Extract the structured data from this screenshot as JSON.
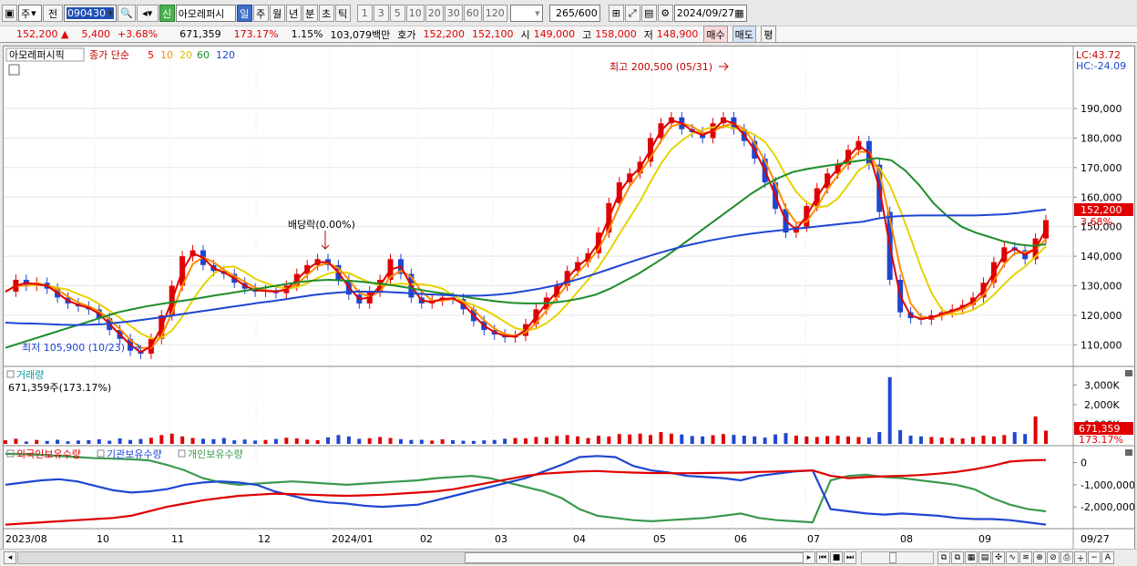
{
  "toolbar": {
    "mode": "주",
    "prev_label": "전",
    "code": "090430",
    "new_label": "신",
    "stock_name": "아모레퍼시",
    "periods": [
      "일",
      "주",
      "월",
      "년",
      "분",
      "초",
      "틱"
    ],
    "active_period": "일",
    "intervals": [
      "1",
      "3",
      "5",
      "10",
      "20",
      "30",
      "60",
      "120"
    ],
    "count_shown": "265",
    "count_total": "/600",
    "date": "2024/09/27"
  },
  "quote": {
    "price": "152,200",
    "change": "5,400",
    "change_pct": "+3.68%",
    "volume": "671,359",
    "volume_ratio": "173.17%",
    "turnover_pct": "1.15%",
    "amount": "103,079백만",
    "hoga_label": "호가",
    "ask": "152,200",
    "bid": "152,100",
    "open_label": "시",
    "open": "149,000",
    "high_label": "고",
    "high": "158,000",
    "low_label": "저",
    "low": "148,900",
    "buy_label": "매수",
    "sell_label": "매도",
    "eval_label": "평"
  },
  "legend": {
    "name": "아모레퍼시픽",
    "ma_label": "종가 단순",
    "mas": [
      "5",
      "10",
      "20",
      "60",
      "120"
    ],
    "ma_colors": [
      "#e00000",
      "#ff8c00",
      "#e6d200",
      "#1e8c2a",
      "#1e46d2"
    ]
  },
  "lc_label": "LC:43.72",
  "hc_label": "HC:-24.09",
  "chart_data": [
    {
      "type": "line",
      "title": "아모레퍼시픽",
      "y_ticks": [
        "190,000",
        "180,000",
        "170,000",
        "160,000",
        "150,000",
        "140,000",
        "130,000",
        "120,000",
        "110,000"
      ],
      "ylim": [
        103000,
        211000
      ],
      "last_price_label": "152,200",
      "last_pct_label": "3.68%",
      "annotations": {
        "high": "최고 200,500 (05/31)",
        "low": "최저 105,900 (10/23)",
        "dividend": "배당락(0.00%)"
      },
      "x_ticks": [
        "2023/08",
        "10",
        "11",
        "12",
        "2024/01",
        "02",
        "03",
        "04",
        "05",
        "06",
        "07",
        "08",
        "09",
        "09/27"
      ],
      "closes": [
        128000,
        132000,
        130000,
        131000,
        129000,
        126000,
        124000,
        123000,
        122000,
        119000,
        115000,
        112000,
        108000,
        107000,
        112000,
        120000,
        130000,
        140000,
        142000,
        137000,
        135000,
        134000,
        131000,
        129000,
        128000,
        128500,
        127500,
        130000,
        134000,
        137000,
        139000,
        137000,
        132000,
        127000,
        124000,
        128000,
        132000,
        139000,
        134000,
        126000,
        124000,
        125000,
        126000,
        125500,
        122000,
        118000,
        115000,
        113500,
        112500,
        113000,
        117000,
        122000,
        126000,
        130000,
        135000,
        138000,
        141000,
        148000,
        158000,
        165000,
        168000,
        172000,
        180000,
        185000,
        187000,
        183000,
        182000,
        180000,
        185000,
        187000,
        183000,
        179000,
        173000,
        165000,
        156000,
        148000,
        150000,
        157000,
        163000,
        168000,
        171000,
        176000,
        179000,
        171000,
        155000,
        132000,
        121000,
        119000,
        118500,
        120000,
        121000,
        122000,
        123500,
        126000,
        131000,
        138000,
        143000,
        142000,
        139000,
        146000,
        152200
      ],
      "ma60": [
        109000,
        110500,
        112000,
        113500,
        115000,
        116500,
        118000,
        119500,
        121000,
        122000,
        123000,
        123800,
        124500,
        125200,
        126000,
        126800,
        127500,
        128300,
        129000,
        129800,
        130600,
        131300,
        131800,
        132000,
        131800,
        131500,
        131000,
        130500,
        129800,
        129000,
        128200,
        127500,
        126800,
        126000,
        125300,
        124700,
        124200,
        124000,
        124000,
        124300,
        124900,
        125800,
        127000,
        129000,
        131500,
        134000,
        137000,
        140000,
        143500,
        147000,
        150500,
        154000,
        157500,
        161000,
        164000,
        166500,
        168500,
        169500,
        170300,
        171000,
        171800,
        172500,
        173200,
        172500,
        169000,
        164000,
        158000,
        153500,
        150000,
        148000,
        146500,
        145000,
        144000,
        143500,
        144000
      ],
      "ma120": [
        117500,
        117300,
        117200,
        117000,
        116800,
        116700,
        116800,
        117000,
        117500,
        118000,
        118600,
        119300,
        120000,
        120700,
        121400,
        122100,
        122800,
        123500,
        124200,
        124800,
        125500,
        126200,
        126900,
        127400,
        127800,
        128000,
        128000,
        127900,
        127700,
        127400,
        127100,
        126900,
        126700,
        126600,
        126700,
        127000,
        127500,
        128200,
        129000,
        130000,
        131200,
        132600,
        134100,
        135700,
        137300,
        138900,
        140400,
        141800,
        143100,
        144200,
        145200,
        146100,
        146900,
        147600,
        148200,
        148700,
        149200,
        149700,
        150200,
        150700,
        151200,
        151700,
        152700,
        153400,
        153700,
        153800,
        153800,
        153800,
        153800,
        153800,
        154000,
        154200,
        154600,
        155200,
        155800
      ]
    },
    {
      "type": "bar",
      "title": "거래량",
      "caption": "671,359주(173.17%)",
      "y_ticks": [
        "3,000K",
        "2,000K",
        "1,000K"
      ],
      "ylim": [
        0,
        3900
      ],
      "unit": "K",
      "last_label": "671,359",
      "last_pct_label": "173.17%",
      "values": [
        180,
        260,
        120,
        200,
        150,
        210,
        130,
        170,
        190,
        230,
        160,
        280,
        200,
        250,
        310,
        450,
        520,
        380,
        300,
        260,
        240,
        300,
        180,
        220,
        170,
        200,
        250,
        310,
        280,
        220,
        190,
        330,
        450,
        380,
        260,
        290,
        350,
        300,
        240,
        200,
        210,
        170,
        230,
        190,
        160,
        150,
        180,
        200,
        260,
        300,
        280,
        350,
        320,
        400,
        450,
        380,
        300,
        420,
        380,
        500,
        480,
        520,
        450,
        600,
        520,
        480,
        400,
        380,
        440,
        500,
        460,
        420,
        380,
        320,
        480,
        550,
        420,
        380,
        350,
        400,
        420,
        380,
        350,
        320,
        600,
        3400,
        700,
        420,
        380,
        350,
        320,
        300,
        280,
        350,
        420,
        380,
        450,
        600,
        500,
        1400,
        671
      ]
    },
    {
      "type": "line",
      "series_names": [
        "외국인보유수량",
        "기관보유수량",
        "개인보유수량"
      ],
      "series_colors": [
        "#e00000",
        "#1e46d2",
        "#3a9a4e"
      ],
      "y_ticks": [
        "0",
        "-1,000,000",
        "-2,000,000"
      ],
      "ylim": [
        -2900000,
        600000
      ],
      "foreign": [
        -2800000,
        -2750000,
        -2700000,
        -2650000,
        -2600000,
        -2550000,
        -2500000,
        -2400000,
        -2200000,
        -2000000,
        -1850000,
        -1700000,
        -1600000,
        -1500000,
        -1450000,
        -1400000,
        -1420000,
        -1450000,
        -1480000,
        -1500000,
        -1480000,
        -1450000,
        -1400000,
        -1350000,
        -1300000,
        -1200000,
        -1050000,
        -900000,
        -750000,
        -600000,
        -500000,
        -450000,
        -400000,
        -380000,
        -420000,
        -450000,
        -470000,
        -480000,
        -480000,
        -470000,
        -460000,
        -450000,
        -420000,
        -400000,
        -380000,
        -350000,
        -600000,
        -700000,
        -650000,
        -620000,
        -600000,
        -560000,
        -500000,
        -420000,
        -300000,
        -150000,
        50000,
        100000,
        120000
      ],
      "institution": [
        -1000000,
        -900000,
        -800000,
        -750000,
        -850000,
        -1050000,
        -1250000,
        -1350000,
        -1300000,
        -1200000,
        -1000000,
        -900000,
        -850000,
        -900000,
        -1000000,
        -1300000,
        -1500000,
        -1700000,
        -1800000,
        -1850000,
        -1950000,
        -2000000,
        -1950000,
        -1900000,
        -1700000,
        -1500000,
        -1300000,
        -1100000,
        -900000,
        -700000,
        -400000,
        -100000,
        250000,
        300000,
        250000,
        -150000,
        -350000,
        -450000,
        -600000,
        -650000,
        -700000,
        -800000,
        -600000,
        -500000,
        -400000,
        -350000,
        -2100000,
        -2200000,
        -2300000,
        -2350000,
        -2300000,
        -2350000,
        -2400000,
        -2500000,
        -2550000,
        -2550000,
        -2600000,
        -2700000,
        -2800000
      ],
      "individual": [
        400000,
        380000,
        350000,
        300000,
        250000,
        200000,
        180000,
        150000,
        100000,
        -100000,
        -350000,
        -700000,
        -900000,
        -1000000,
        -950000,
        -900000,
        -850000,
        -900000,
        -950000,
        -1000000,
        -950000,
        -900000,
        -850000,
        -800000,
        -700000,
        -650000,
        -600000,
        -700000,
        -900000,
        -1100000,
        -1300000,
        -1600000,
        -2100000,
        -2400000,
        -2500000,
        -2600000,
        -2650000,
        -2600000,
        -2550000,
        -2500000,
        -2400000,
        -2300000,
        -2500000,
        -2600000,
        -2650000,
        -2700000,
        -800000,
        -600000,
        -550000,
        -650000,
        -700000,
        -800000,
        -900000,
        -1000000,
        -1200000,
        -1600000,
        -1900000,
        -2100000,
        -2200000
      ]
    }
  ]
}
